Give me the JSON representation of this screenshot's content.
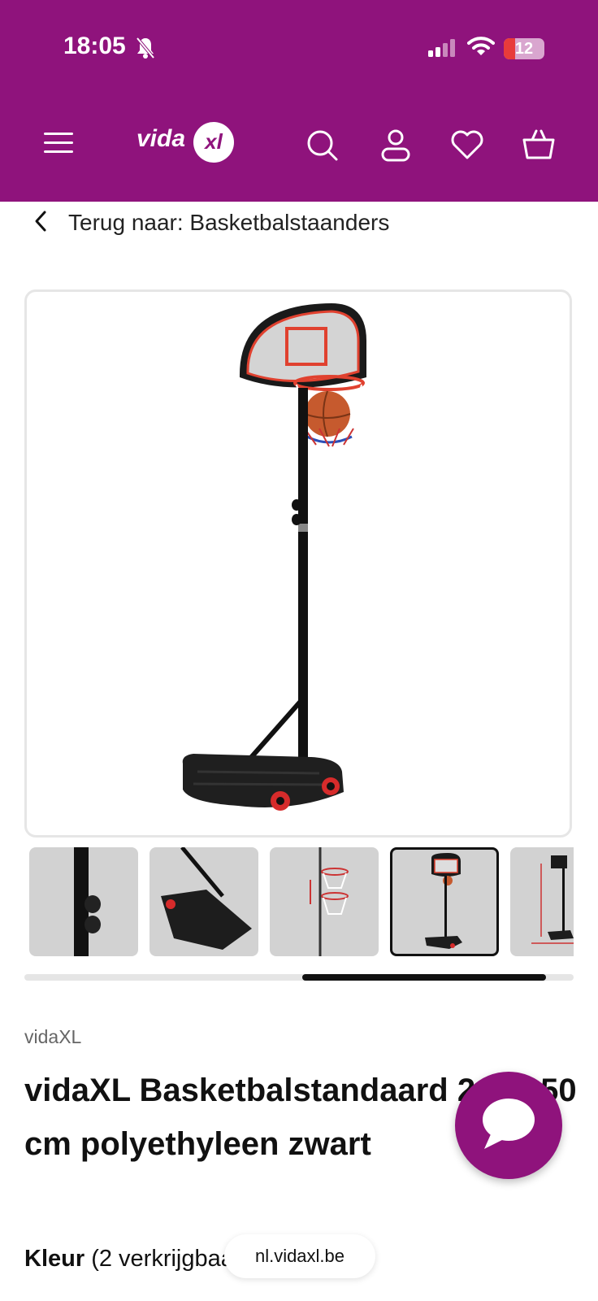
{
  "status_bar": {
    "time": "18:05",
    "battery_level": "12",
    "icons": [
      "bell-muted-icon",
      "cellular-signal-icon",
      "wifi-icon",
      "battery-icon"
    ]
  },
  "header": {
    "background": "#8f137c",
    "logo": {
      "text": "vidaxl",
      "part1": "vida",
      "part2": "xl"
    },
    "icons": [
      "menu-icon",
      "search-icon",
      "account-icon",
      "wishlist-heart-icon",
      "cart-basket-icon"
    ]
  },
  "breadcrumb": {
    "back_label": "Terug naar: Basketbalstaanders"
  },
  "gallery": {
    "selected_index": 3,
    "thumbnails": [
      "pole-detail",
      "base-detail",
      "height-range",
      "full-product",
      "dimensions"
    ],
    "scroll_position": 0.5
  },
  "product": {
    "brand": "vidaXL",
    "title": "vidaXL Basketbalstandaard 216-250 cm polyethyleen zwart"
  },
  "options": {
    "color_label": "Kleur",
    "availability": "(2 verkrijgbaar)"
  },
  "browser": {
    "url": "nl.vidaxl.be"
  },
  "chat": {
    "icon": "chat-bubble-icon"
  }
}
